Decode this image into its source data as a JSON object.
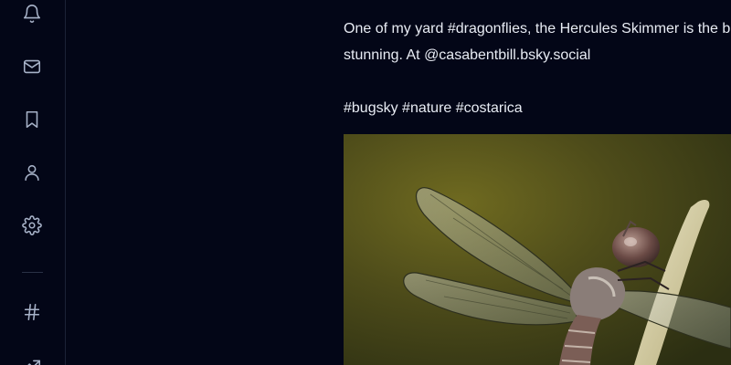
{
  "sidebar": {
    "items": [
      {
        "name": "notifications",
        "icon": "bell-icon"
      },
      {
        "name": "messages",
        "icon": "mail-icon"
      },
      {
        "name": "saved",
        "icon": "bookmark-icon"
      },
      {
        "name": "profile",
        "icon": "person-icon"
      },
      {
        "name": "settings",
        "icon": "gear-icon"
      },
      {
        "name": "feeds",
        "icon": "hash-icon"
      },
      {
        "name": "trending",
        "icon": "trending-icon"
      }
    ]
  },
  "post": {
    "text_lines": [
      "One of my yard #dragonflies, the Hercules Skimmer is the big,",
      "stunning. At @casabentbill.bsky.social"
    ],
    "hashtags": "#bugsky #nature #costarica",
    "image": {
      "subject": "dragonfly-photo"
    }
  },
  "colors": {
    "background": "#030617",
    "text": "#e8ecf4",
    "icon": "#a7b2c8",
    "border": "#1b2236"
  }
}
